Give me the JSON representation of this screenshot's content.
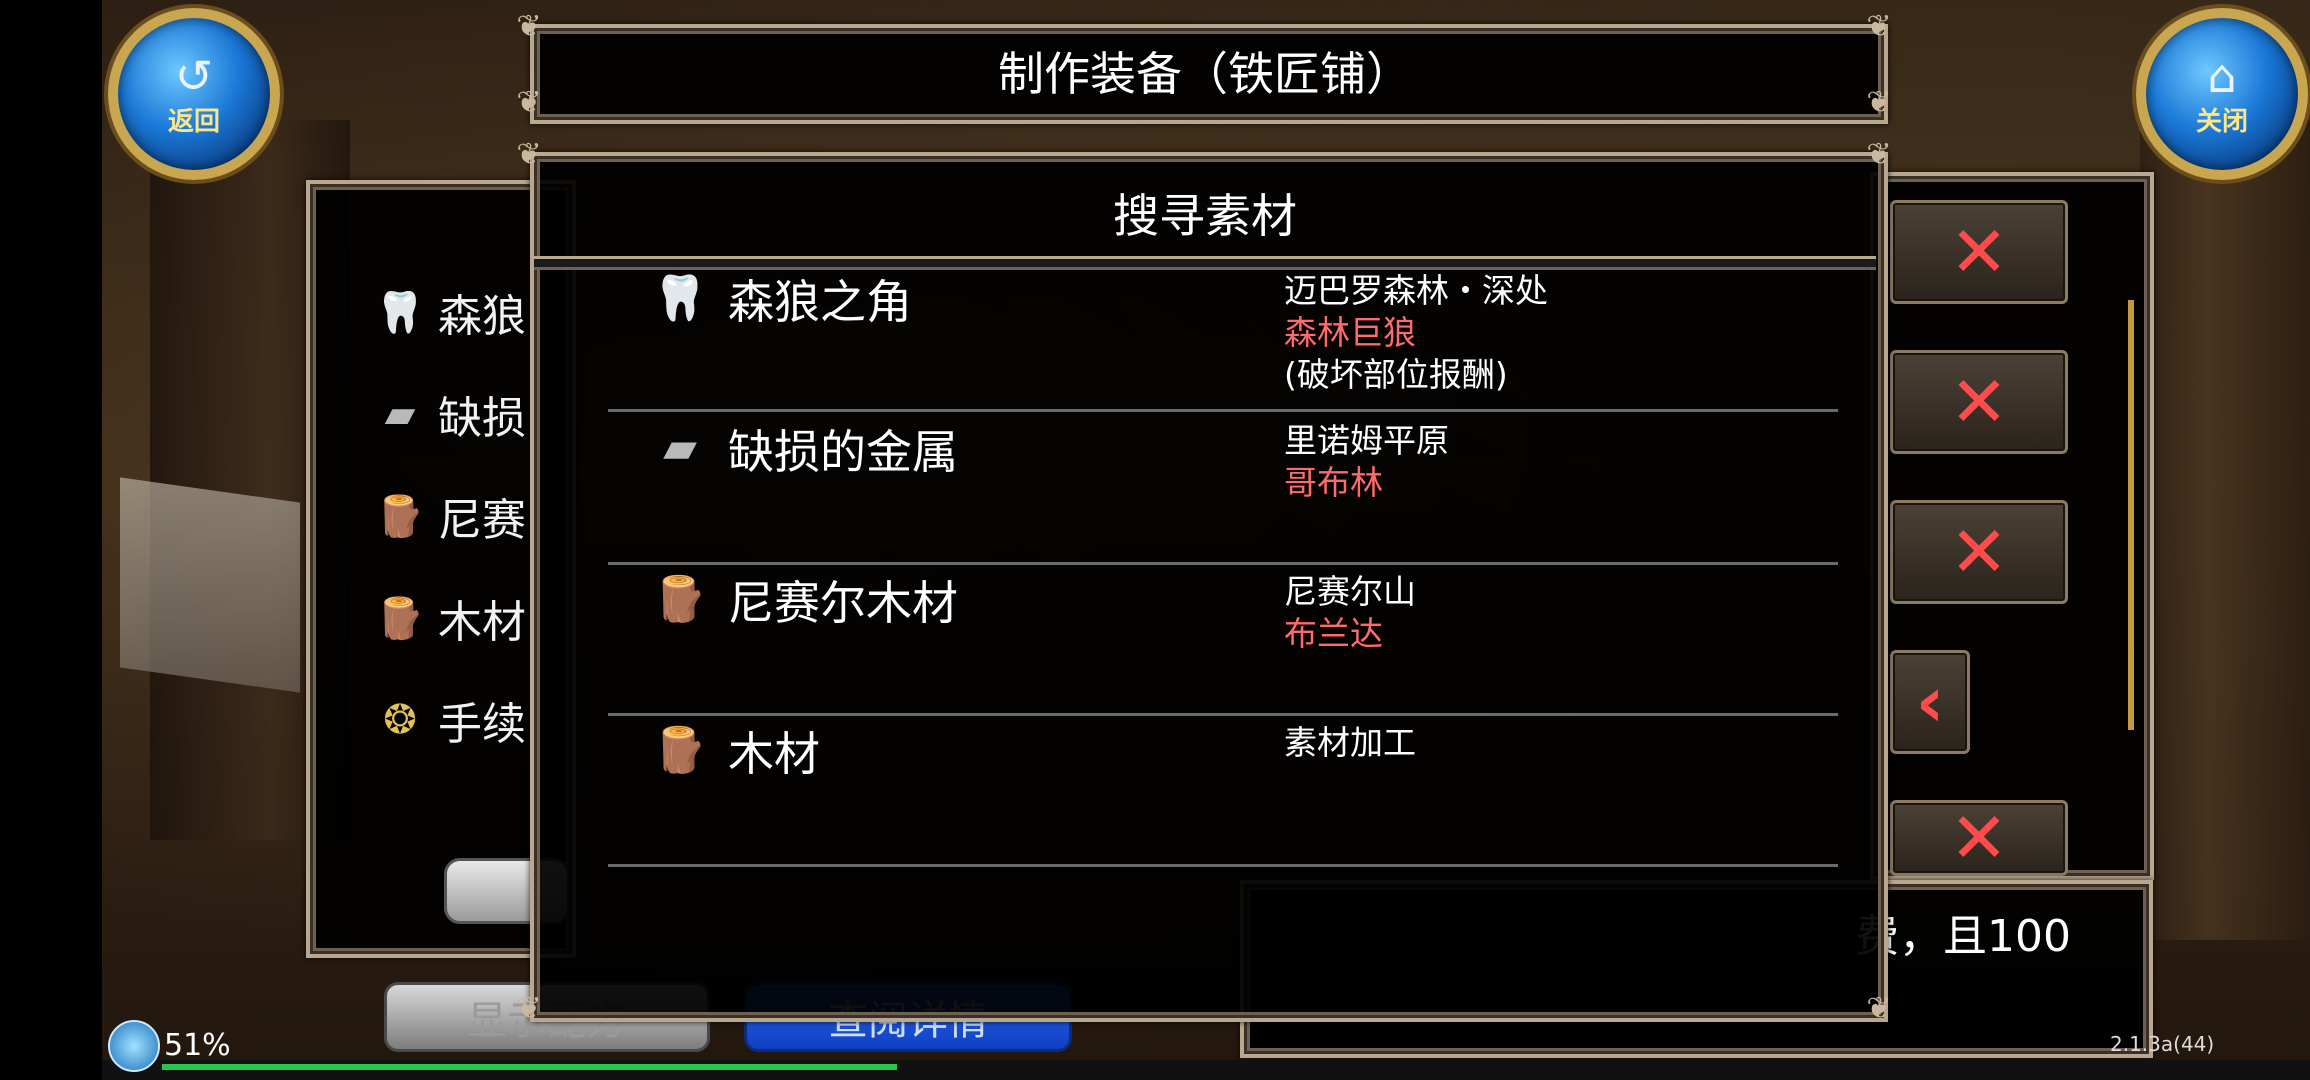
{
  "header": {
    "title": "制作装备（铁匠铺）"
  },
  "buttons": {
    "back_label": "返回",
    "close_label": "关闭"
  },
  "dialog": {
    "title": "搜寻素材",
    "rows": [
      {
        "icon": "fang-icon",
        "glyph": "🦷",
        "name": "森狼之角",
        "place": "迈巴罗森林・深处",
        "enemy": "森林巨狼",
        "note": "(破坏部位报酬)"
      },
      {
        "icon": "metal-ingot-icon",
        "glyph": "▰",
        "name": "缺损的金属",
        "place": "里诺姆平原",
        "enemy": "哥布林",
        "note": ""
      },
      {
        "icon": "wood-log-icon",
        "glyph": "🪵",
        "name": "尼赛尔木材",
        "place": "尼赛尔山",
        "enemy": "布兰达",
        "note": ""
      },
      {
        "icon": "wood-log-icon",
        "glyph": "🪵",
        "name": "木材",
        "place": "素材加工",
        "enemy": "",
        "note": ""
      }
    ]
  },
  "background_panel": {
    "items": [
      {
        "icon": "fang-icon",
        "text": "森狼"
      },
      {
        "icon": "metal-ingot-icon",
        "text": "缺损"
      },
      {
        "icon": "wood-log-icon",
        "text": "尼赛"
      },
      {
        "icon": "wood-log-icon",
        "text": "木材"
      },
      {
        "icon": "coins-icon",
        "text": "手续"
      }
    ],
    "partial_text": "费，且100",
    "show_recipe_label": "显示配方",
    "view_details_label": "查阅详情"
  },
  "status": {
    "battery": "51%",
    "version": "2.1.3a(44)",
    "progress": 0.35
  },
  "colors": {
    "enemy": "#ff6a6a",
    "x_button": "#ff4b4b",
    "gold_ring": "#c9a650"
  }
}
